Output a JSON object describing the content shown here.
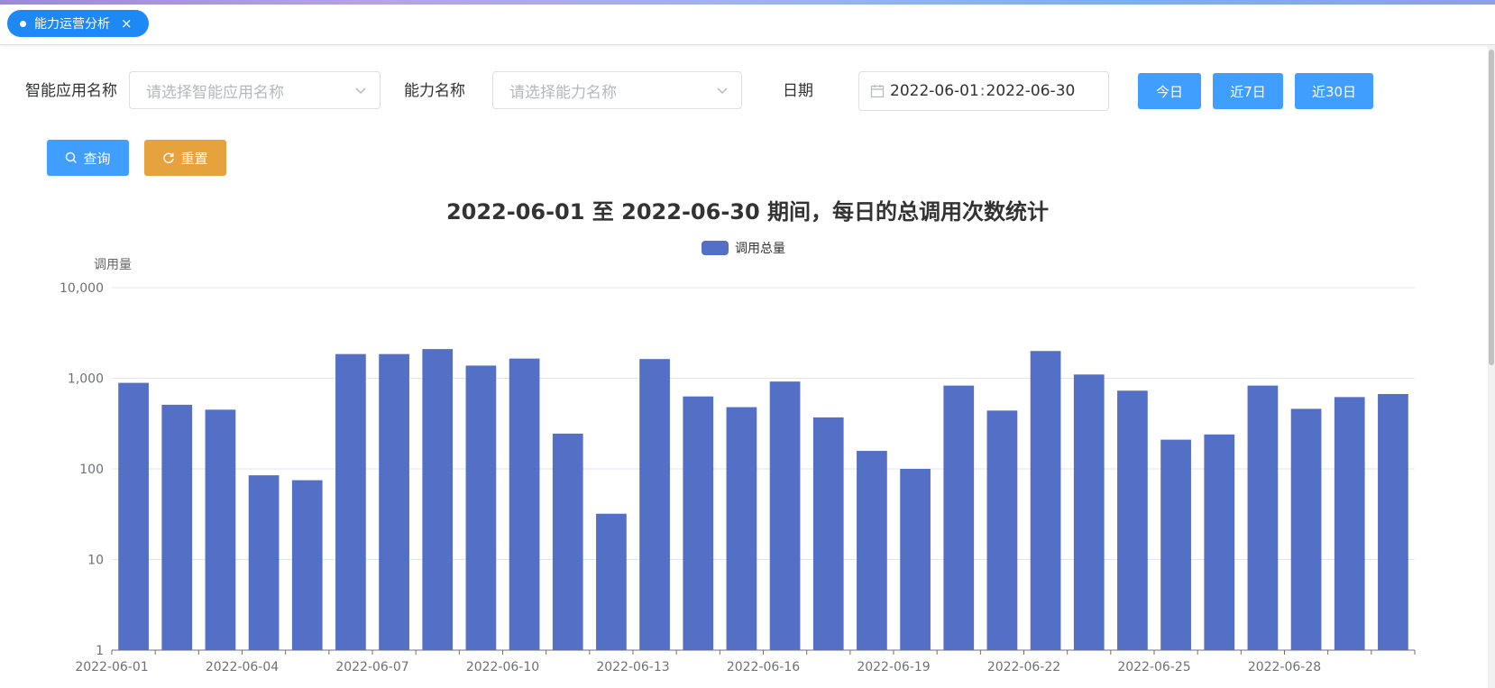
{
  "tab": {
    "label": "能力运营分析",
    "close": "×"
  },
  "filters": {
    "app_label": "智能应用名称",
    "app_placeholder": "请选择智能应用名称",
    "capability_label": "能力名称",
    "capability_placeholder": "请选择能力名称",
    "date_label": "日期",
    "date_start": "2022-06-01",
    "date_sep": ":",
    "date_end": "2022-06-30"
  },
  "buttons": {
    "today": "今日",
    "last7": "近7日",
    "last30": "近30日",
    "query": "查询",
    "reset": "重置"
  },
  "colors": {
    "primary": "#409eff",
    "warning": "#e6a23c",
    "tab": "#1e88f5",
    "bar": "#5470c6"
  },
  "chart_data": {
    "type": "bar",
    "title": "2022-06-01 至 2022-06-30 期间，每日的总调用次数统计",
    "ylabel": "调用量",
    "yscale": "log",
    "ylim": [
      1,
      10000
    ],
    "yticks": [
      "1",
      "10",
      "100",
      "1,000",
      "10,000"
    ],
    "legend": "top-center",
    "series": [
      {
        "name": "调用总量",
        "values": [
          890,
          510,
          450,
          85,
          75,
          1850,
          1850,
          2100,
          1380,
          1650,
          245,
          32,
          1630,
          630,
          480,
          920,
          370,
          158,
          100,
          830,
          440,
          2000,
          1100,
          730,
          210,
          240,
          830,
          460,
          620,
          670
        ]
      }
    ],
    "categories": [
      "2022-06-01",
      "2022-06-02",
      "2022-06-03",
      "2022-06-04",
      "2022-06-05",
      "2022-06-06",
      "2022-06-07",
      "2022-06-08",
      "2022-06-09",
      "2022-06-10",
      "2022-06-11",
      "2022-06-12",
      "2022-06-13",
      "2022-06-14",
      "2022-06-15",
      "2022-06-16",
      "2022-06-17",
      "2022-06-18",
      "2022-06-19",
      "2022-06-20",
      "2022-06-21",
      "2022-06-22",
      "2022-06-23",
      "2022-06-24",
      "2022-06-25",
      "2022-06-26",
      "2022-06-27",
      "2022-06-28",
      "2022-06-29",
      "2022-06-30"
    ],
    "xtick_labels": [
      "2022-06-01",
      "2022-06-04",
      "2022-06-07",
      "2022-06-10",
      "2022-06-13",
      "2022-06-16",
      "2022-06-19",
      "2022-06-22",
      "2022-06-25",
      "2022-06-28"
    ]
  }
}
